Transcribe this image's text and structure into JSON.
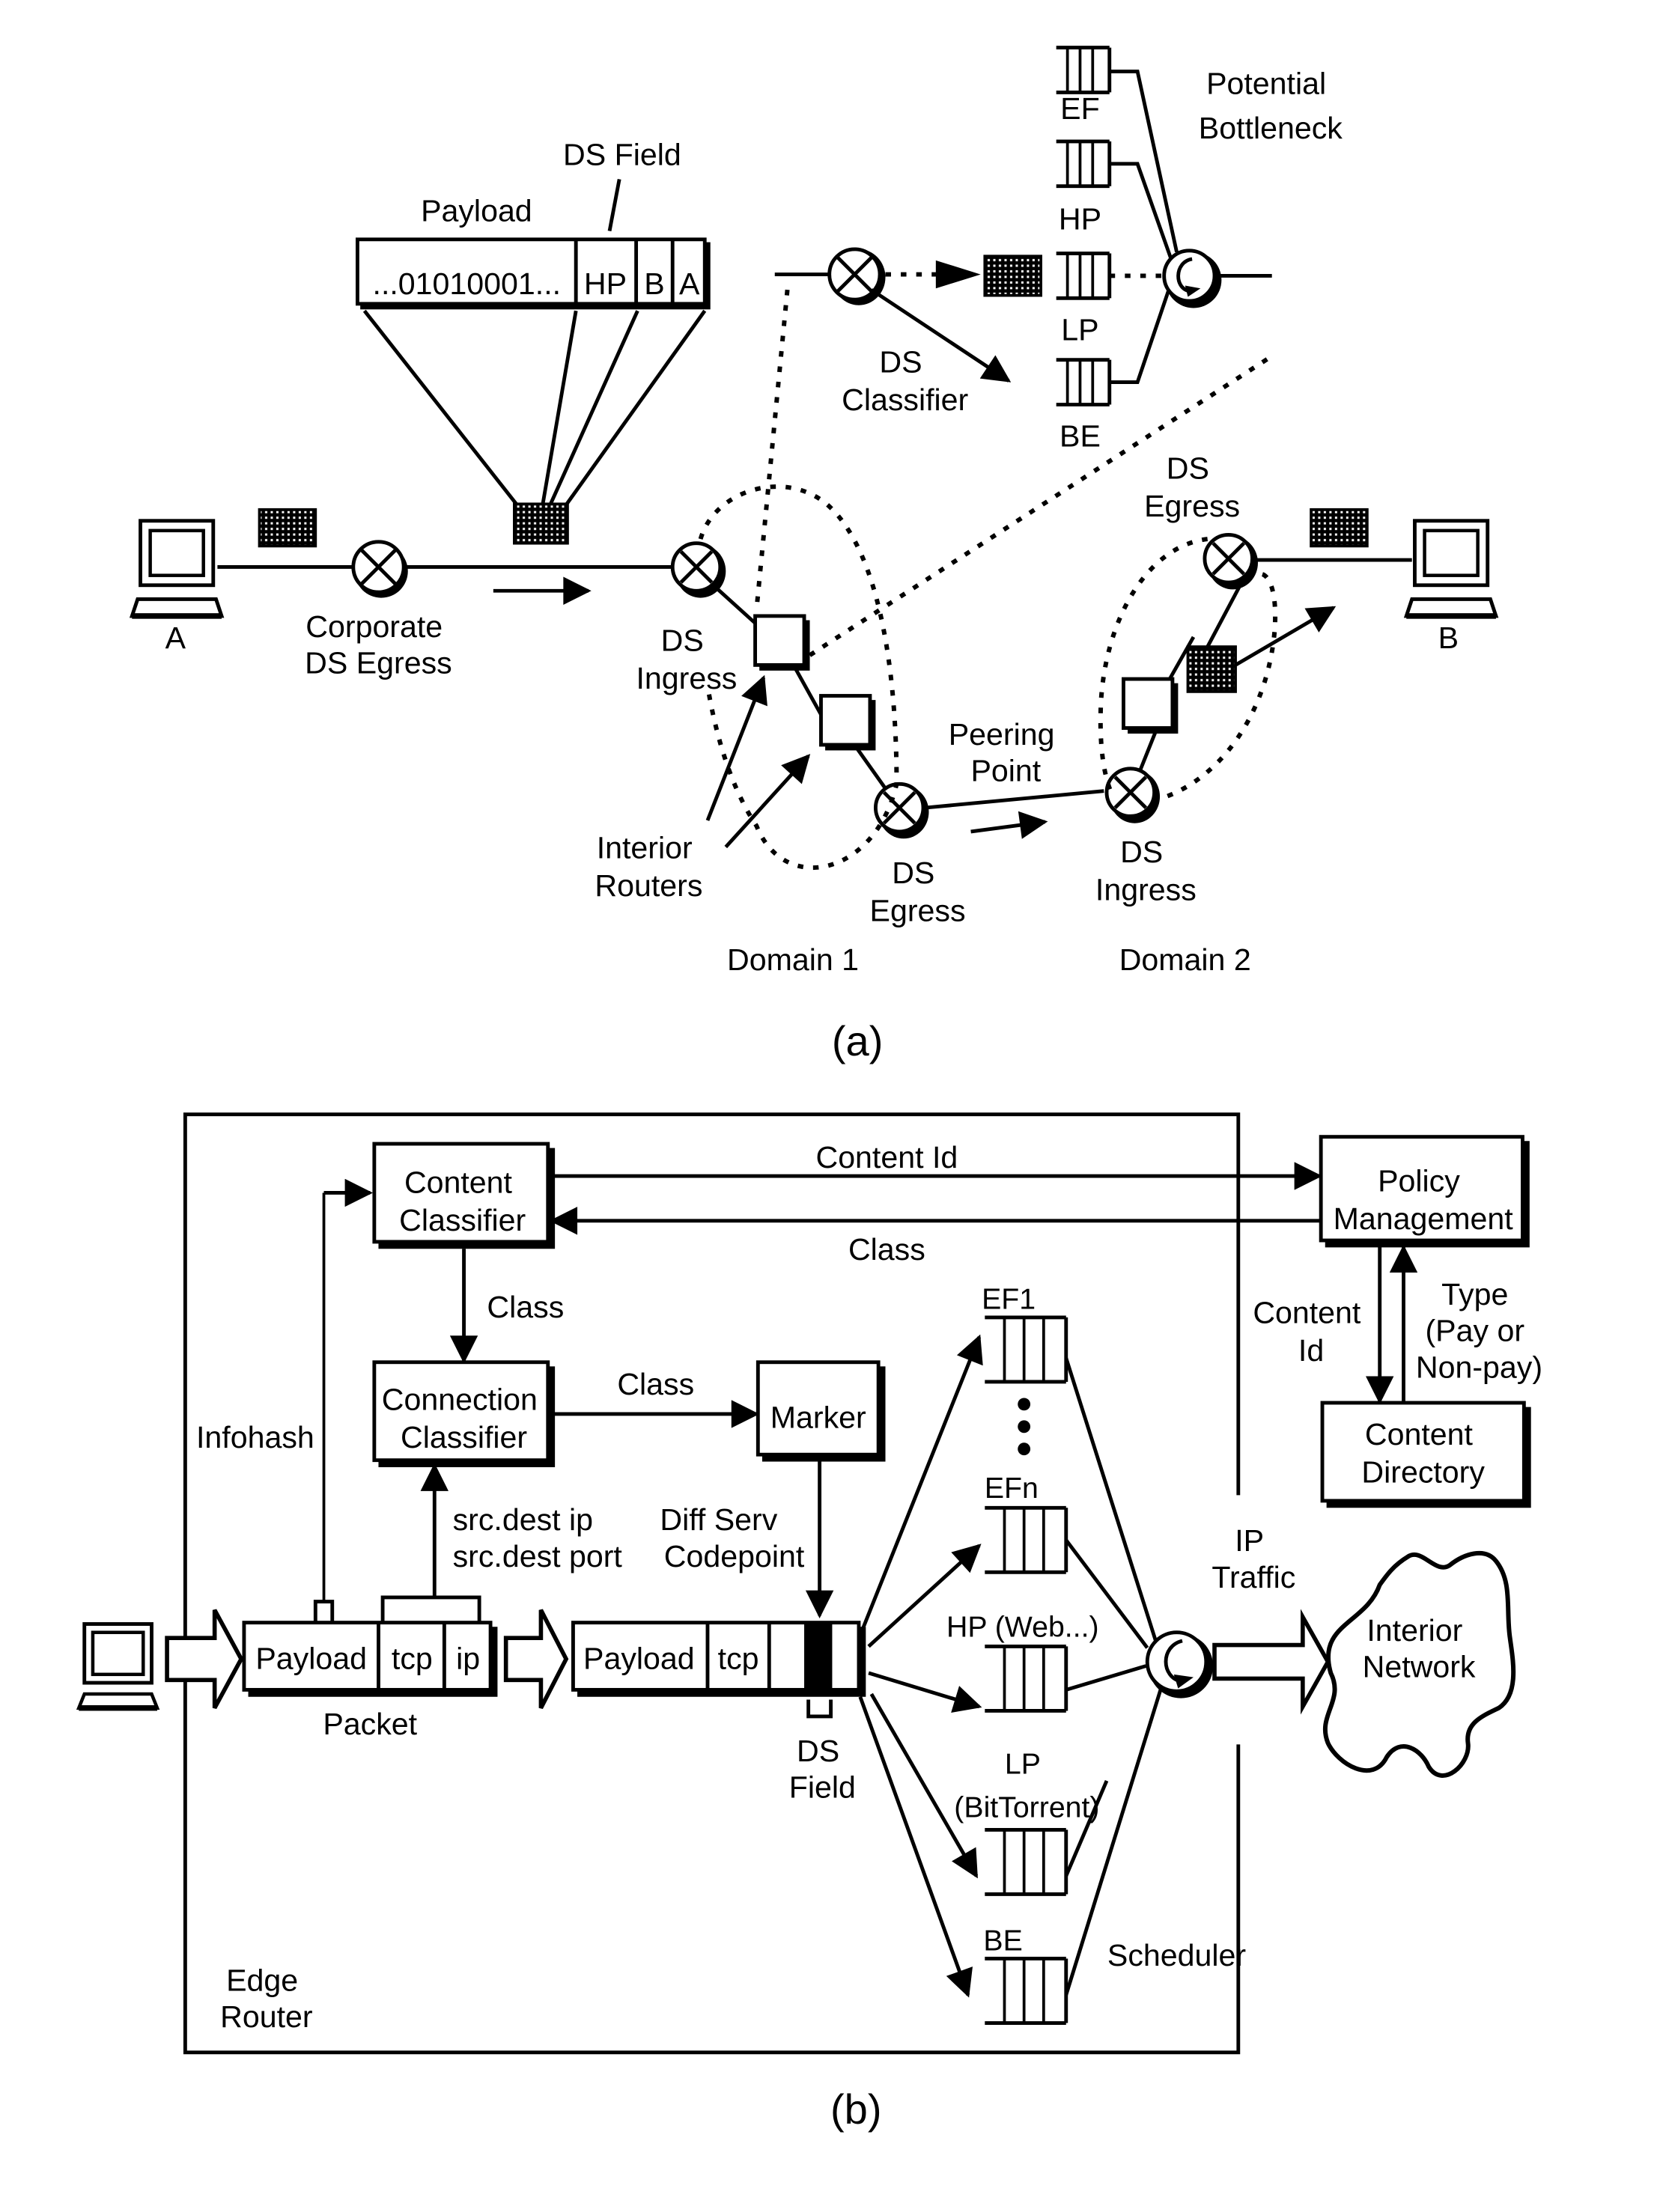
{
  "figure_a": {
    "caption": "(a)",
    "hosts": {
      "left": "A",
      "right": "B"
    },
    "payload_label": "Payload",
    "ds_field_label": "DS Field",
    "packet_fields": [
      "...01010001...",
      "HP",
      "B",
      "A"
    ],
    "potential_bottleneck": [
      "Potential",
      "Bottleneck"
    ],
    "ds_classifier": [
      "DS",
      "Classifier"
    ],
    "queues": [
      "EF",
      "HP",
      "LP",
      "BE"
    ],
    "corporate_egress": [
      "Corporate",
      "DS Egress"
    ],
    "ds_ingress_1": [
      "DS",
      "Ingress"
    ],
    "interior_routers": [
      "Interior",
      "Routers"
    ],
    "ds_egress_1": [
      "DS",
      "Egress"
    ],
    "peering_point": [
      "Peering",
      "Point"
    ],
    "ds_ingress_2": [
      "DS",
      "Ingress"
    ],
    "ds_egress_2": [
      "DS",
      "Egress"
    ],
    "domain1": "Domain 1",
    "domain2": "Domain 2"
  },
  "figure_b": {
    "caption": "(b)",
    "edge_router": [
      "Edge",
      "Router"
    ],
    "content_classifier": [
      "Content",
      "Classifier"
    ],
    "connection_classifier": [
      "Connection",
      "Classifier"
    ],
    "marker": "Marker",
    "policy_management": [
      "Policy",
      "Management"
    ],
    "content_directory": [
      "Content",
      "Directory"
    ],
    "content_id_top": "Content Id",
    "class_return": "Class",
    "class_down": "Class",
    "class_right": "Class",
    "infohash": "Infohash",
    "src_dest": [
      "src.dest ip",
      "src.dest port"
    ],
    "diffserv": [
      "Diff Serv",
      "Codepoint"
    ],
    "content_id_side": [
      "Content",
      "Id"
    ],
    "type_side": [
      "Type",
      "(Pay or",
      "Non-pay)"
    ],
    "packet_fields": [
      "Payload",
      "tcp",
      "ip"
    ],
    "packet_label": "Packet",
    "marked_fields": [
      "Payload",
      "tcp"
    ],
    "ds_field": [
      "DS",
      "Field"
    ],
    "queues": {
      "ef1": "EF1",
      "efn": "EFn",
      "hp": "HP (Web...)",
      "lp": [
        "LP",
        "(BitTorrent)"
      ],
      "be": "BE"
    },
    "scheduler": "Scheduler",
    "ip_traffic": [
      "IP",
      "Traffic"
    ],
    "interior_network": [
      "Interior",
      "Network"
    ]
  }
}
